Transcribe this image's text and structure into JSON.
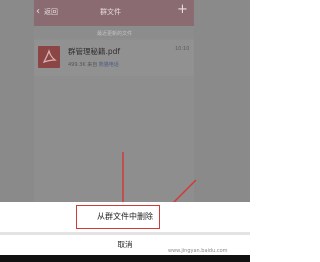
{
  "header": {
    "back_label": "返回",
    "title": "群文件",
    "add_icon": "plus-icon",
    "back_icon": "chevron-left-icon"
  },
  "section": {
    "label": "最近更新的文件"
  },
  "file": {
    "name": "群管理秘籍.pdf",
    "time": "10:10",
    "size": "499.3K",
    "source": "来自",
    "owner": "熊猫电话",
    "icon": "pdf-file-icon"
  },
  "action_sheet": {
    "delete_label": "从群文件中删除",
    "cancel_label": "取消"
  },
  "watermark": "www.jingyan.baidu.com",
  "colors": {
    "nav_bar": "#8a6b72",
    "overlay": "#8e8e8e",
    "annotation": "#d23a3a",
    "pdf_icon": "#8c4545"
  }
}
